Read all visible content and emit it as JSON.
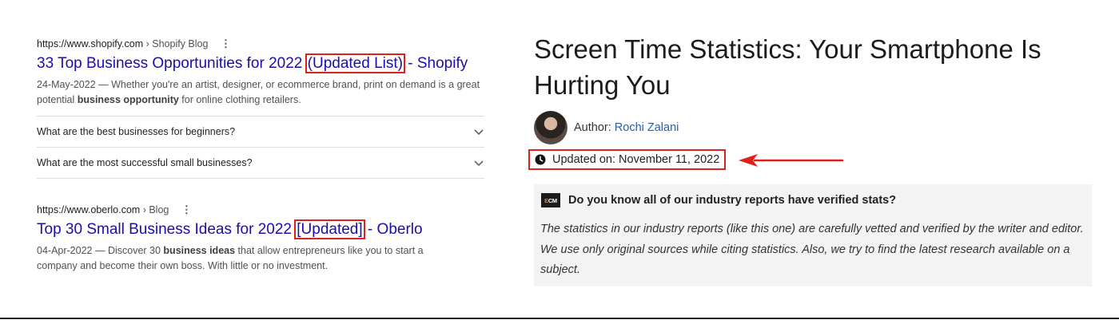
{
  "search_results": [
    {
      "url": "https://www.shopify.com",
      "breadcrumb": " › Shopify Blog",
      "menu_icon": "kebab-icon",
      "title_before": "33 Top Business Opportunities for 2022 ",
      "title_boxed": "(Updated List)",
      "title_after": " - Shopify",
      "snippet_date": "24-May-2022",
      "snippet_p1": " — Whether you're an artist, designer, or ecommerce brand, print on demand is a great potential ",
      "snippet_bold": "business opportunity",
      "snippet_p2": " for online clothing retailers."
    },
    {
      "url": "https://www.oberlo.com",
      "breadcrumb": " › Blog",
      "menu_icon": "kebab-icon",
      "title_before": "Top 30 Small Business Ideas for 2022 ",
      "title_boxed": "[Updated]",
      "title_after": " - Oberlo",
      "snippet_date": "04-Apr-2022",
      "snippet_p1": " — Discover 30 ",
      "snippet_bold": "business ideas",
      "snippet_p2": " that allow entrepreneurs like you to start a company and become their own boss. With little or no investment."
    }
  ],
  "people_also_ask": [
    "What are the best businesses for beginners?",
    "What are the most successful small businesses?"
  ],
  "article": {
    "title": "Screen Time Statistics: Your Smartphone Is Hurting You",
    "author_label": "Author: ",
    "author_name": "Rochi Zalani",
    "updated": "Updated on: November 11, 2022",
    "callout_logo": "ECM",
    "callout_heading": "Do you know all of our industry reports have verified stats?",
    "callout_body": "The statistics in our industry reports (like this one) are carefully vetted and verified by the writer and editor. We use only original sources while citing statistics. Also, we try to find the latest research available on a subject."
  },
  "colors": {
    "link": "#1a0dab",
    "highlight_box": "#e0201b",
    "author_link": "#2a5db0",
    "callout_bg": "#f3f3f3"
  }
}
